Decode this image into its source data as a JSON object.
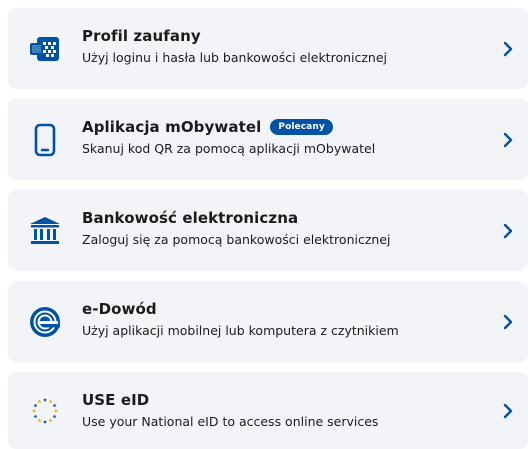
{
  "colors": {
    "card_bg": "#f2f4f7",
    "brand_blue": "#0052a5",
    "text": "#1b1b1b"
  },
  "options": [
    {
      "title": "Profil zaufany",
      "subtitle": "Użyj loginu i hasła lub bankowości elektronicznej",
      "icon": "trusted-profile-icon"
    },
    {
      "title": "Aplikacja mObywatel",
      "badge": "Polecany",
      "subtitle": "Skanuj kod QR za pomocą aplikacji mObywatel",
      "icon": "smartphone-icon"
    },
    {
      "title": "Bankowość elektroniczna",
      "subtitle": "Zaloguj się za pomocą bankowości elektronicznej",
      "icon": "bank-icon"
    },
    {
      "title": "e-Dowód",
      "subtitle": "Użyj aplikacji mobilnej lub komputera z czytnikiem",
      "icon": "e-id-card-icon"
    },
    {
      "title": "USE eID",
      "subtitle": "Use your National eID to access online services",
      "icon": "eu-stars-icon"
    }
  ]
}
